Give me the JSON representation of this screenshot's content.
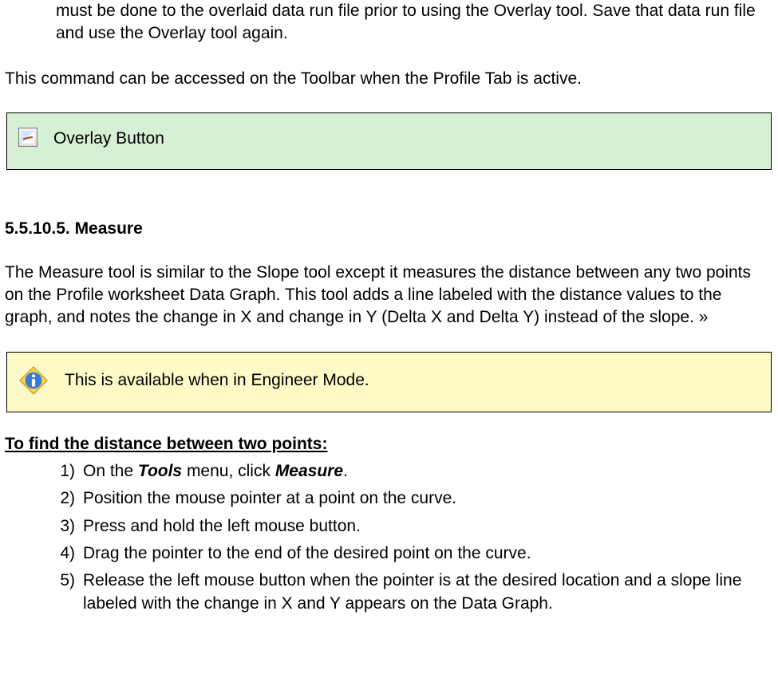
{
  "intro_fragment": "must be done to the overlaid data run file prior to using the Overlay tool. Save that data run file and use the Overlay tool again.",
  "access_line": "This command can be accessed on the Toolbar when the Profile Tab is active.",
  "overlay_button_label": "Overlay Button",
  "section_number": "5.5.10.5. Measure",
  "measure_para": "The Measure tool is similar to the Slope tool except it measures the distance between any two points on the Profile worksheet Data Graph. This tool adds a line labeled with the distance values to the graph, and notes the change in X and change in Y (Delta X and Delta Y) instead of the slope. »",
  "note_text": "This is available when in Engineer Mode.",
  "subhead": "To find the distance between two points:",
  "steps": [
    {
      "n": "1)",
      "pre": "On the ",
      "m1": "Tools",
      "mid": " menu, click ",
      "m2": "Measure",
      "post": "."
    },
    {
      "n": "2)",
      "text": "Position the mouse pointer at a point on the curve."
    },
    {
      "n": "3)",
      "text": "Press and hold the left mouse button."
    },
    {
      "n": "4)",
      "text": "Drag the pointer to the end of the desired point on the curve."
    },
    {
      "n": "5)",
      "text": "Release the left mouse button when the pointer is at the desired location and a slope line labeled with the change in X and Y appears on the Data Graph."
    }
  ]
}
